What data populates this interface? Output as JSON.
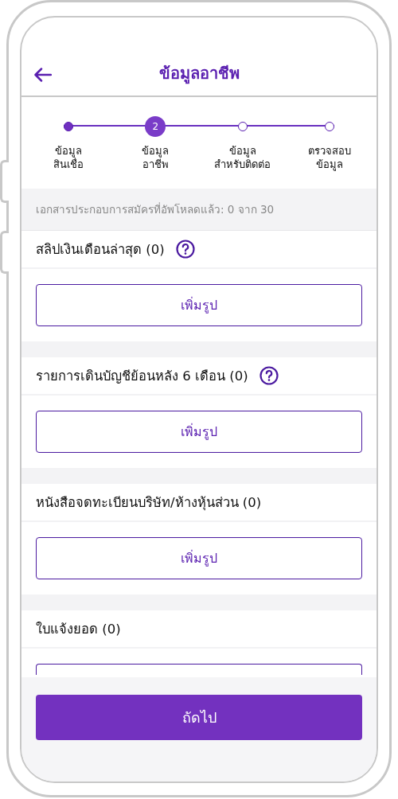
{
  "header": {
    "title": "ข้อมูลอาชีพ"
  },
  "stepper": [
    {
      "label": "ข้อมูล\nสินเชื่อ",
      "done": true,
      "selected": false
    },
    {
      "label": "ข้อมูล\nอาชีพ",
      "done": false,
      "selected": true,
      "number": "2"
    },
    {
      "label": "ข้อมูล\nสำหรับติดต่อ",
      "done": false,
      "selected": false
    },
    {
      "label": "ตรวจสอบ\nข้อมูล",
      "done": false,
      "selected": false
    }
  ],
  "notice": "เอกสารประกอบการสมัครที่อัพโหลดแล้ว: 0 จาก 30",
  "documents": [
    {
      "title": "สลิปเงินเดือนล่าสุด (0)",
      "help": true,
      "button": "เพิ่มรูป"
    },
    {
      "title": "รายการเดินบัญชีย้อนหลัง 6 เดือน (0)",
      "help": true,
      "button": "เพิ่มรูป"
    },
    {
      "title": "หนังสือจดทะเบียนบริษัท/ห้างหุ้นส่วน (0)",
      "help": false,
      "button": "เพิ่มรูป"
    },
    {
      "title": "ใบแจ้งยอด (0)",
      "help": false
    }
  ],
  "next_button": "ถัดไป"
}
